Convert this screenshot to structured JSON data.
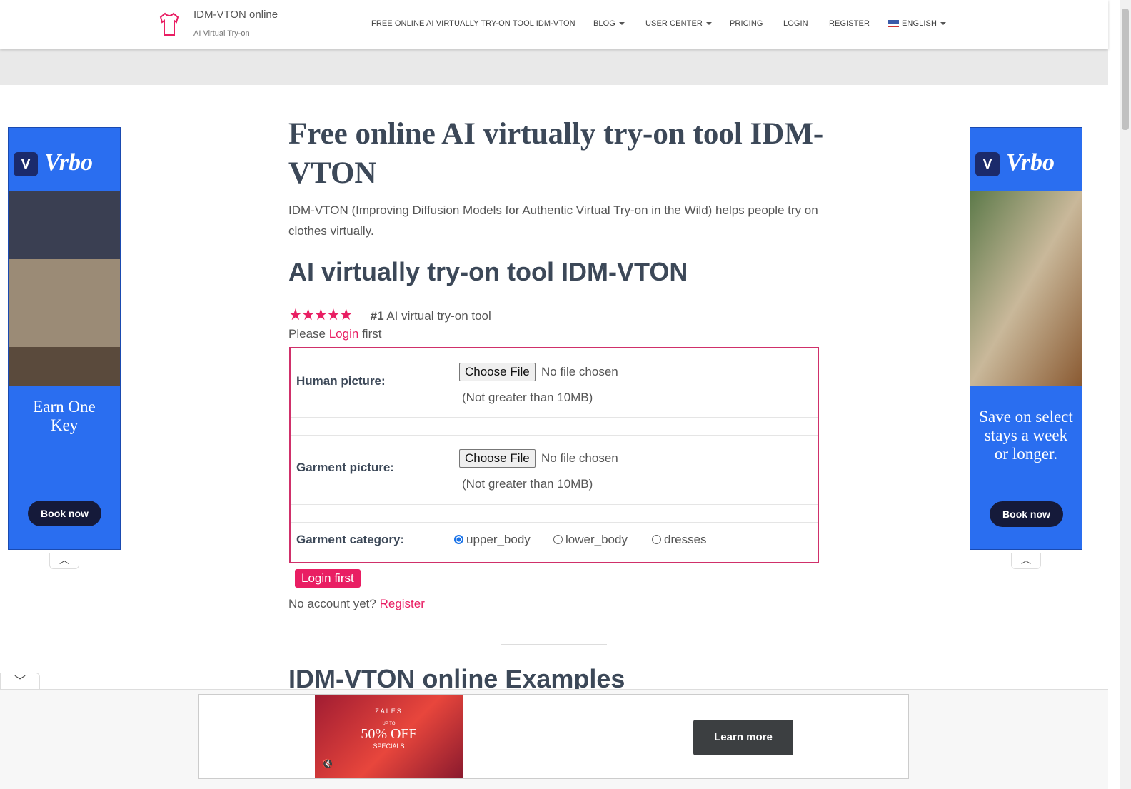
{
  "nav": {
    "brand": "IDM-VTON online",
    "tagline": "AI Virtual Try-on",
    "items": [
      {
        "label": "FREE ONLINE AI VIRTUALLY TRY-ON TOOL IDM-VTON"
      },
      {
        "label": "BLOG"
      },
      {
        "label": "USER CENTER"
      },
      {
        "label": "PRICING"
      },
      {
        "label": "LOGIN"
      },
      {
        "label": "REGISTER"
      },
      {
        "label": "ENGLISH"
      }
    ]
  },
  "main": {
    "title": "Free online AI virtually try-on tool IDM-VTON",
    "intro": "IDM-VTON (Improving Diffusion Models for Authentic Virtual Try-on in the Wild) helps people try on clothes virtually.",
    "subtitle": "AI virtually try-on tool IDM-VTON",
    "rating": 5,
    "rank": "#1",
    "rank_text": "AI virtual try-on tool",
    "please": "Please",
    "login_link": "Login",
    "first": "first",
    "form": {
      "human_label": "Human picture:",
      "garment_label": "Garment picture:",
      "choose": "Choose File",
      "no_file": "No file chosen",
      "size_note": "(Not greater than 10MB)",
      "category_label": "Garment category:",
      "categories": [
        "upper_body",
        "lower_body",
        "dresses"
      ],
      "selected": "upper_body"
    },
    "login_button": "Login first",
    "no_account": "No account yet?",
    "register_link": "Register",
    "examples_title": "IDM-VTON online Examples"
  },
  "ads": {
    "brand": "Vrbo",
    "left_text": "Earn One Key",
    "right_text": "Save on select stays a week or longer.",
    "book": "Book now",
    "bottom": {
      "brand": "ZALES",
      "upto": "UP TO",
      "offer": "50% OFF",
      "specials": "SPECIALS",
      "cta": "Learn more"
    }
  },
  "colors": {
    "accent": "#e91e63",
    "ad_blue": "#2a6ef0"
  }
}
